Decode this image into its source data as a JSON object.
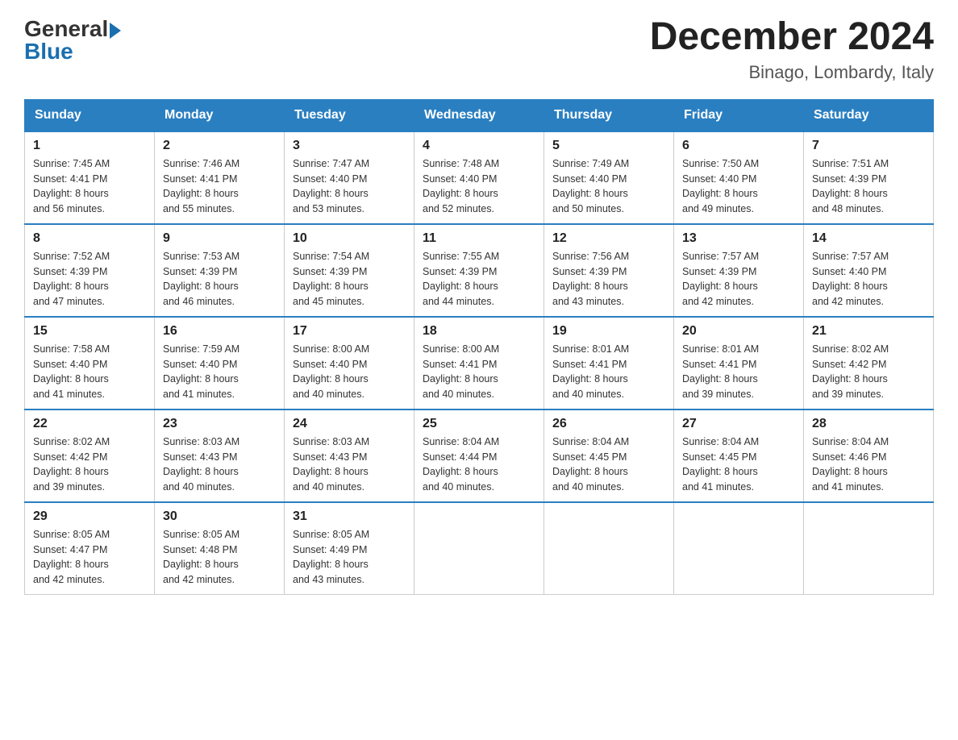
{
  "logo": {
    "general": "General",
    "blue": "Blue",
    "arrow_color": "#1a6faf"
  },
  "title": {
    "month_year": "December 2024",
    "location": "Binago, Lombardy, Italy"
  },
  "days_of_week": [
    "Sunday",
    "Monday",
    "Tuesday",
    "Wednesday",
    "Thursday",
    "Friday",
    "Saturday"
  ],
  "weeks": [
    [
      {
        "day": "1",
        "sunrise": "7:45 AM",
        "sunset": "4:41 PM",
        "daylight": "8 hours and 56 minutes."
      },
      {
        "day": "2",
        "sunrise": "7:46 AM",
        "sunset": "4:41 PM",
        "daylight": "8 hours and 55 minutes."
      },
      {
        "day": "3",
        "sunrise": "7:47 AM",
        "sunset": "4:40 PM",
        "daylight": "8 hours and 53 minutes."
      },
      {
        "day": "4",
        "sunrise": "7:48 AM",
        "sunset": "4:40 PM",
        "daylight": "8 hours and 52 minutes."
      },
      {
        "day": "5",
        "sunrise": "7:49 AM",
        "sunset": "4:40 PM",
        "daylight": "8 hours and 50 minutes."
      },
      {
        "day": "6",
        "sunrise": "7:50 AM",
        "sunset": "4:40 PM",
        "daylight": "8 hours and 49 minutes."
      },
      {
        "day": "7",
        "sunrise": "7:51 AM",
        "sunset": "4:39 PM",
        "daylight": "8 hours and 48 minutes."
      }
    ],
    [
      {
        "day": "8",
        "sunrise": "7:52 AM",
        "sunset": "4:39 PM",
        "daylight": "8 hours and 47 minutes."
      },
      {
        "day": "9",
        "sunrise": "7:53 AM",
        "sunset": "4:39 PM",
        "daylight": "8 hours and 46 minutes."
      },
      {
        "day": "10",
        "sunrise": "7:54 AM",
        "sunset": "4:39 PM",
        "daylight": "8 hours and 45 minutes."
      },
      {
        "day": "11",
        "sunrise": "7:55 AM",
        "sunset": "4:39 PM",
        "daylight": "8 hours and 44 minutes."
      },
      {
        "day": "12",
        "sunrise": "7:56 AM",
        "sunset": "4:39 PM",
        "daylight": "8 hours and 43 minutes."
      },
      {
        "day": "13",
        "sunrise": "7:57 AM",
        "sunset": "4:39 PM",
        "daylight": "8 hours and 42 minutes."
      },
      {
        "day": "14",
        "sunrise": "7:57 AM",
        "sunset": "4:40 PM",
        "daylight": "8 hours and 42 minutes."
      }
    ],
    [
      {
        "day": "15",
        "sunrise": "7:58 AM",
        "sunset": "4:40 PM",
        "daylight": "8 hours and 41 minutes."
      },
      {
        "day": "16",
        "sunrise": "7:59 AM",
        "sunset": "4:40 PM",
        "daylight": "8 hours and 41 minutes."
      },
      {
        "day": "17",
        "sunrise": "8:00 AM",
        "sunset": "4:40 PM",
        "daylight": "8 hours and 40 minutes."
      },
      {
        "day": "18",
        "sunrise": "8:00 AM",
        "sunset": "4:41 PM",
        "daylight": "8 hours and 40 minutes."
      },
      {
        "day": "19",
        "sunrise": "8:01 AM",
        "sunset": "4:41 PM",
        "daylight": "8 hours and 40 minutes."
      },
      {
        "day": "20",
        "sunrise": "8:01 AM",
        "sunset": "4:41 PM",
        "daylight": "8 hours and 39 minutes."
      },
      {
        "day": "21",
        "sunrise": "8:02 AM",
        "sunset": "4:42 PM",
        "daylight": "8 hours and 39 minutes."
      }
    ],
    [
      {
        "day": "22",
        "sunrise": "8:02 AM",
        "sunset": "4:42 PM",
        "daylight": "8 hours and 39 minutes."
      },
      {
        "day": "23",
        "sunrise": "8:03 AM",
        "sunset": "4:43 PM",
        "daylight": "8 hours and 40 minutes."
      },
      {
        "day": "24",
        "sunrise": "8:03 AM",
        "sunset": "4:43 PM",
        "daylight": "8 hours and 40 minutes."
      },
      {
        "day": "25",
        "sunrise": "8:04 AM",
        "sunset": "4:44 PM",
        "daylight": "8 hours and 40 minutes."
      },
      {
        "day": "26",
        "sunrise": "8:04 AM",
        "sunset": "4:45 PM",
        "daylight": "8 hours and 40 minutes."
      },
      {
        "day": "27",
        "sunrise": "8:04 AM",
        "sunset": "4:45 PM",
        "daylight": "8 hours and 41 minutes."
      },
      {
        "day": "28",
        "sunrise": "8:04 AM",
        "sunset": "4:46 PM",
        "daylight": "8 hours and 41 minutes."
      }
    ],
    [
      {
        "day": "29",
        "sunrise": "8:05 AM",
        "sunset": "4:47 PM",
        "daylight": "8 hours and 42 minutes."
      },
      {
        "day": "30",
        "sunrise": "8:05 AM",
        "sunset": "4:48 PM",
        "daylight": "8 hours and 42 minutes."
      },
      {
        "day": "31",
        "sunrise": "8:05 AM",
        "sunset": "4:49 PM",
        "daylight": "8 hours and 43 minutes."
      },
      null,
      null,
      null,
      null
    ]
  ],
  "labels": {
    "sunrise": "Sunrise:",
    "sunset": "Sunset:",
    "daylight": "Daylight:"
  }
}
